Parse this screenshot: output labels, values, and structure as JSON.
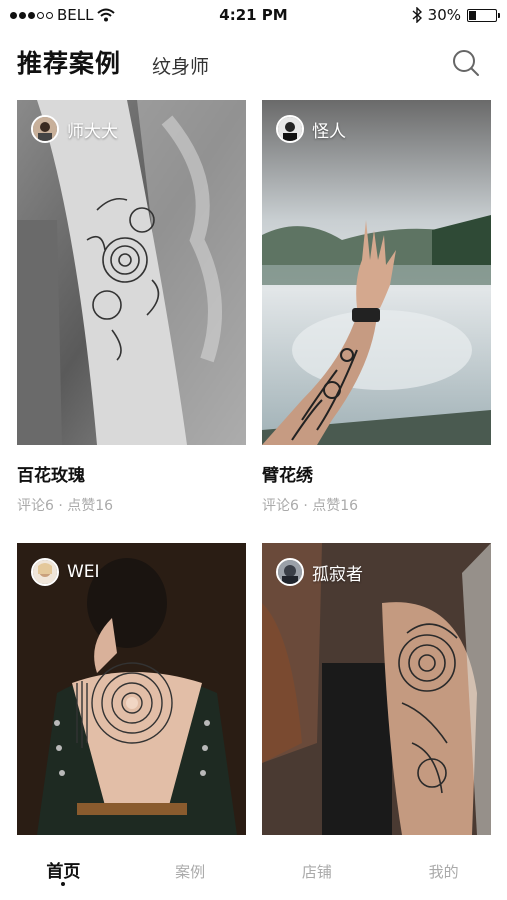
{
  "status_bar": {
    "carrier": "BELL",
    "time": "4:21 PM",
    "battery_percent": "30%",
    "battery_level": 0.3,
    "signal_dots_filled": 3,
    "signal_dots_total": 5
  },
  "header": {
    "tab_active": "推荐案例",
    "tab_other": "纹身师",
    "search_icon": "search-icon"
  },
  "cards": [
    {
      "author": "师大大",
      "title": "百花玫瑰",
      "meta": "评论6 · 点赞16"
    },
    {
      "author": "怪人",
      "title": "臂花绣",
      "meta": "评论6 · 点赞16"
    },
    {
      "author": "WEI"
    },
    {
      "author": "孤寂者"
    }
  ],
  "bottom_nav": {
    "items": [
      "首页",
      "案例",
      "店铺",
      "我的"
    ],
    "active_index": 0
  }
}
